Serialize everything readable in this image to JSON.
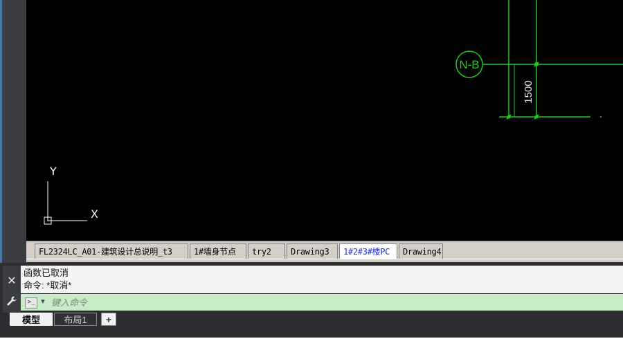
{
  "canvas": {
    "ucs_x_label": "X",
    "ucs_y_label": "Y",
    "axis_bubble_label": "N-B",
    "dimension_value": "1500",
    "colors": {
      "background": "#000000",
      "geometry": "#22c822",
      "ucs": "#ffffff"
    }
  },
  "file_tabs": [
    {
      "label": "FL2324LC_A01-建筑设计总说明_t3",
      "active": false
    },
    {
      "label": "1#墙身节点",
      "active": false
    },
    {
      "label": "try2",
      "active": false
    },
    {
      "label": "Drawing3",
      "active": false
    },
    {
      "label": "1#2#3#楼PC",
      "active": true
    },
    {
      "label": "Drawing4",
      "active": false
    }
  ],
  "command": {
    "history": [
      "函数已取消",
      "命令: *取消*"
    ],
    "placeholder": "键入命令",
    "close_icon": "close-icon",
    "customize_icon": "wrench-icon",
    "prompt_icon": "command-prompt-icon",
    "prompt_symbol": ">_"
  },
  "layout_tabs": [
    {
      "label": "模型",
      "active": true
    },
    {
      "label": "布局1",
      "active": false
    }
  ],
  "add_layout_label": "+"
}
